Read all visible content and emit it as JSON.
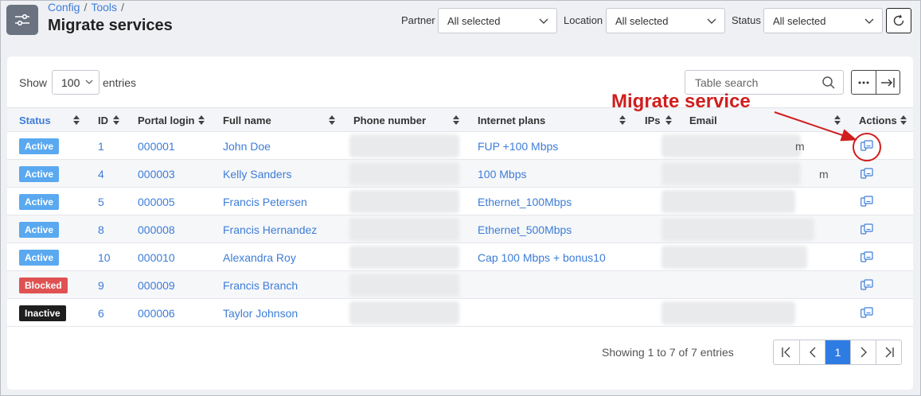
{
  "header": {
    "breadcrumb": [
      "Config",
      "Tools"
    ],
    "breadcrumb_trailing_sep": "/",
    "title": "Migrate services",
    "menu_icon": "sliders-icon"
  },
  "filters": {
    "partner": {
      "label": "Partner",
      "value": "All selected"
    },
    "location": {
      "label": "Location",
      "value": "All selected"
    },
    "status": {
      "label": "Status",
      "value": "All selected"
    }
  },
  "toolbar": {
    "show_label": "Show",
    "entries_value": "100",
    "entries_label": "entries",
    "search_placeholder": "Table search"
  },
  "table": {
    "columns": [
      "Status",
      "ID",
      "Portal login",
      "Full name",
      "Phone number",
      "Internet plans",
      "IPs",
      "Email",
      "Actions"
    ],
    "rows": [
      {
        "status": "Active",
        "id": "1",
        "login": "000001",
        "name": "John Doe",
        "plan": "FUP +100 Mbps",
        "email_visible": "m"
      },
      {
        "status": "Active",
        "id": "4",
        "login": "000003",
        "name": "Kelly Sanders",
        "plan": "100 Mbps",
        "email_visible": "m"
      },
      {
        "status": "Active",
        "id": "5",
        "login": "000005",
        "name": "Francis Petersen",
        "plan": "Ethernet_100Mbps",
        "email_visible": ""
      },
      {
        "status": "Active",
        "id": "8",
        "login": "000008",
        "name": "Francis Hernandez",
        "plan": "Ethernet_500Mbps",
        "email_visible": ""
      },
      {
        "status": "Active",
        "id": "10",
        "login": "000010",
        "name": "Alexandra Roy",
        "plan": "Cap 100 Mbps + bonus10",
        "email_visible": ""
      },
      {
        "status": "Blocked",
        "id": "9",
        "login": "000009",
        "name": "Francis Branch",
        "plan": "",
        "email_visible": ""
      },
      {
        "status": "Inactive",
        "id": "6",
        "login": "000006",
        "name": "Taylor Johnson",
        "plan": "",
        "email_visible": ""
      }
    ]
  },
  "status_colors": {
    "Active": "#5aa9f0",
    "Blocked": "#e05252",
    "Inactive": "#1e1e1e"
  },
  "annotation": {
    "text": "Migrate service",
    "color": "#d01e1e"
  },
  "footer": {
    "showing": "Showing 1 to 7 of 7 entries",
    "current_page": "1"
  }
}
